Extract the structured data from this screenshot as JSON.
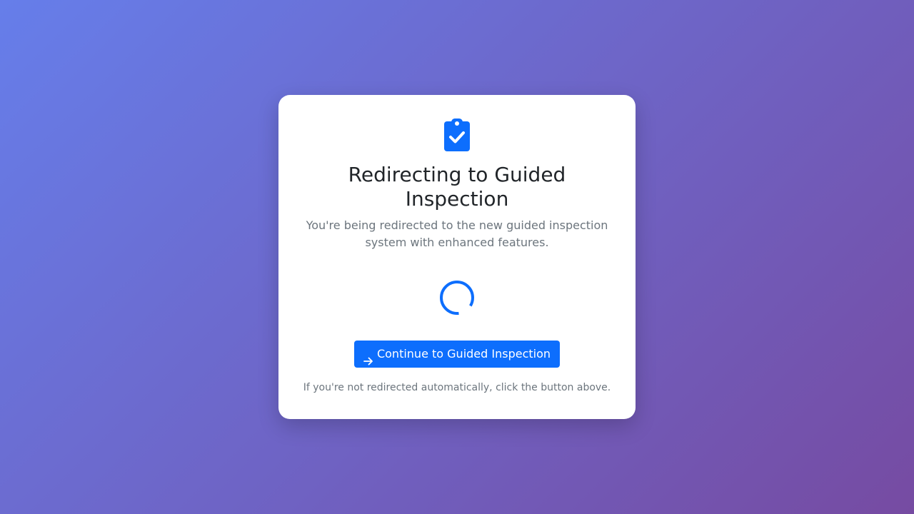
{
  "page": {
    "title": "Redirecting to Guided Inspection",
    "subtitle": "You're being redirected to the new guided inspection system with enhanced features.",
    "button_label": "Continue to Guided Inspection",
    "hint": "If you're not redirected automatically, click the button above."
  },
  "icons": {
    "header": "clipboard-check-icon",
    "button": "arrow-right-icon",
    "loader": "loading-spinner"
  },
  "colors": {
    "accent": "#0d6efd",
    "background_gradient_start": "#667eea",
    "background_gradient_end": "#764ba2",
    "card": "#ffffff",
    "title_text": "#212529",
    "muted_text": "#6c757d"
  }
}
